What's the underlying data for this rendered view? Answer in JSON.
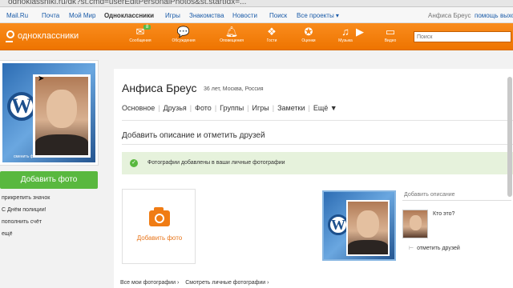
{
  "browser": {
    "url": "odnoklassniki.ru/dk?st.cmd=userEditPersonalPhotos&st.startIdx=..."
  },
  "topstrip": {
    "items": [
      {
        "label": "Mail.Ru"
      },
      {
        "label": "Почта"
      },
      {
        "label": "Мой Мир"
      },
      {
        "label": "Одноклассники"
      },
      {
        "label": "Игры"
      },
      {
        "label": "Знакомства"
      },
      {
        "label": "Новости"
      },
      {
        "label": "Поиск"
      },
      {
        "label": "Все проекты ▾"
      }
    ],
    "user_name": "Анфиса Бреус",
    "help": "помощь",
    "exit": "выход"
  },
  "navbar": {
    "logo": "одноклассники",
    "items": [
      {
        "label": "Сообщения",
        "icon": "envelope-icon",
        "badge": "8"
      },
      {
        "label": "Обсуждения",
        "icon": "chat-bubble-icon"
      },
      {
        "label": "Оповещения",
        "icon": "bell-icon"
      },
      {
        "label": "Гости",
        "icon": "footprints-icon"
      },
      {
        "label": "Оценки",
        "icon": "rating-icon"
      },
      {
        "label": "Музыка",
        "icon": "music-note-icon"
      },
      {
        "label": "Видео",
        "icon": "video-icon"
      }
    ],
    "search_placeholder": "Поиск"
  },
  "sidebar": {
    "change_photo": "сменить фото",
    "add_photo_button": "Добавить фото",
    "links": [
      {
        "label": "прикрепить значок"
      },
      {
        "label": "С Днём полиции!"
      },
      {
        "label": "пополнить счёт"
      },
      {
        "label": "ещё"
      }
    ]
  },
  "profile": {
    "name": "Анфиса Бреус",
    "meta": "36 лет, Москва, Россия",
    "tabs": [
      {
        "label": "Основное"
      },
      {
        "label": "Друзья"
      },
      {
        "label": "Фото"
      },
      {
        "label": "Группы"
      },
      {
        "label": "Игры"
      },
      {
        "label": "Заметки"
      },
      {
        "label": "Ещё ▼"
      }
    ]
  },
  "photo_section": {
    "title": "Добавить описание и отметить друзей",
    "notice": "Фотографии добавлены в ваши личные фотографии",
    "upload_label": "Добавить фото",
    "description_label": "Добавить описание",
    "who_is_it": "Кто это?",
    "tag_friends": "отметить друзей",
    "bottom_links": [
      {
        "label": "Все мои фотографии ›"
      },
      {
        "label": "Смотреть личные фотографии ›"
      }
    ]
  },
  "colors": {
    "nav_orange": "#f98c1d",
    "success_green": "#59b83f",
    "link_blue": "#1a5ba8"
  }
}
